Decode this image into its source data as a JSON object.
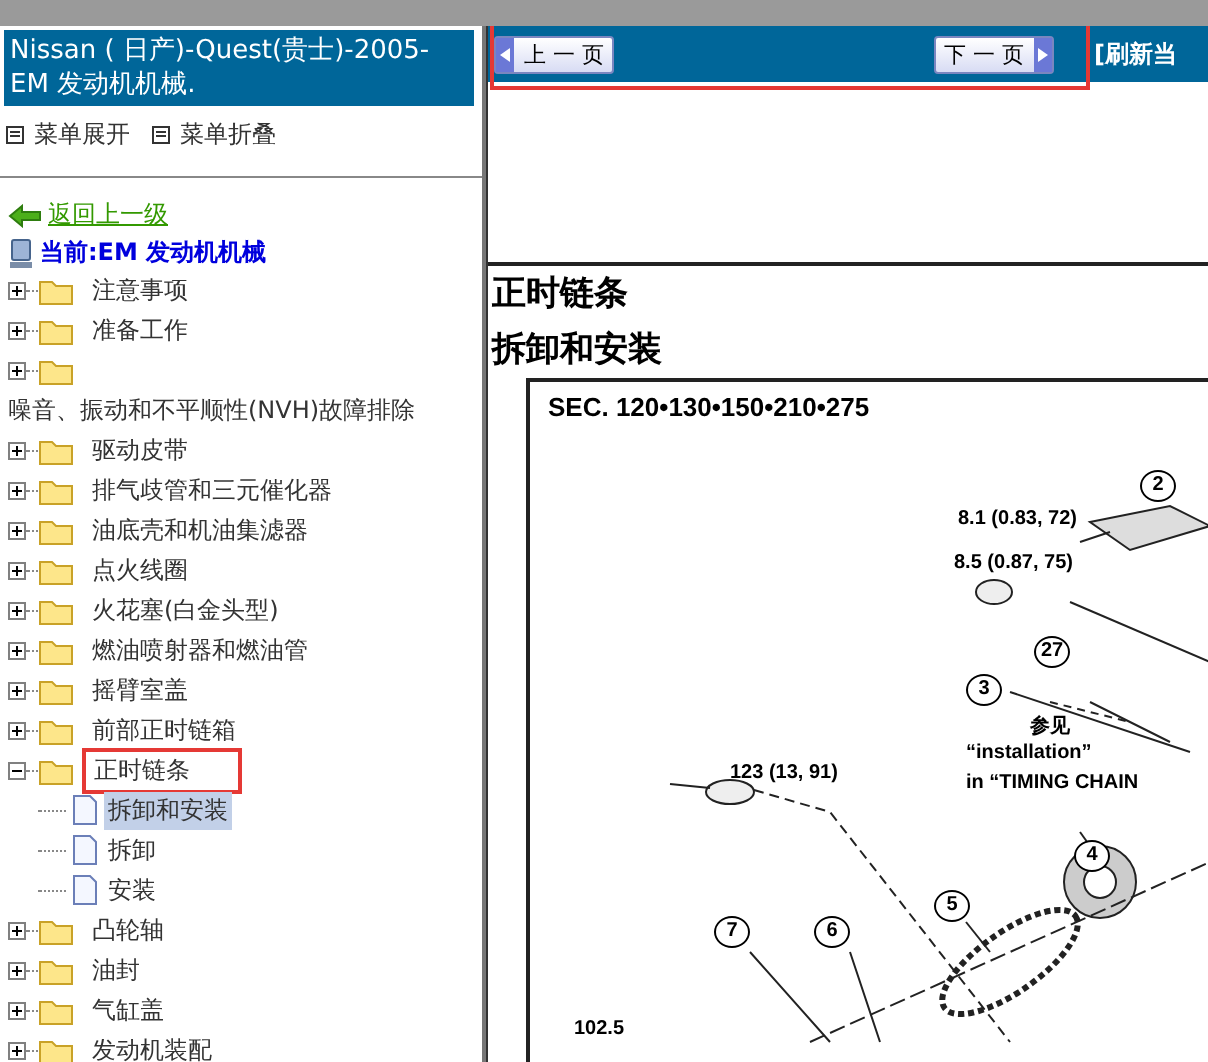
{
  "sidebar": {
    "title": "Nissan ( 日产)-Quest(贵士)-2005- EM 发动机机械.",
    "menu": [
      {
        "label": "菜单展开"
      },
      {
        "label": "菜单折叠"
      }
    ],
    "back_link": "返回上一级",
    "current": "当前:EM 发动机机械",
    "tree": [
      {
        "kind": "folder",
        "label": "注意事项",
        "expanded": false,
        "wrapped": false,
        "highlighted": false
      },
      {
        "kind": "folder",
        "label": "准备工作",
        "expanded": false,
        "wrapped": false,
        "highlighted": false
      },
      {
        "kind": "folder",
        "label": "噪音、振动和不平顺性(NVH)故障排除",
        "expanded": false,
        "wrapped": true,
        "highlighted": false
      },
      {
        "kind": "folder",
        "label": "驱动皮带",
        "expanded": false,
        "wrapped": false,
        "highlighted": false
      },
      {
        "kind": "folder",
        "label": "排气歧管和三元催化器",
        "expanded": false,
        "wrapped": false,
        "highlighted": false
      },
      {
        "kind": "folder",
        "label": "油底壳和机油集滤器",
        "expanded": false,
        "wrapped": false,
        "highlighted": false
      },
      {
        "kind": "folder",
        "label": "点火线圈",
        "expanded": false,
        "wrapped": false,
        "highlighted": false
      },
      {
        "kind": "folder",
        "label": "火花塞(白金头型)",
        "expanded": false,
        "wrapped": false,
        "highlighted": false
      },
      {
        "kind": "folder",
        "label": "燃油喷射器和燃油管",
        "expanded": false,
        "wrapped": false,
        "highlighted": false
      },
      {
        "kind": "folder",
        "label": "摇臂室盖",
        "expanded": false,
        "wrapped": false,
        "highlighted": false
      },
      {
        "kind": "folder",
        "label": "前部正时链箱",
        "expanded": false,
        "wrapped": false,
        "highlighted": false
      },
      {
        "kind": "folder",
        "label": "正时链条",
        "expanded": true,
        "wrapped": false,
        "highlighted": true,
        "children": [
          {
            "kind": "page",
            "label": "拆卸和安装",
            "selected": true
          },
          {
            "kind": "page",
            "label": "拆卸",
            "selected": false
          },
          {
            "kind": "page",
            "label": "安装",
            "selected": false
          }
        ]
      },
      {
        "kind": "folder",
        "label": "凸轮轴",
        "expanded": false,
        "wrapped": false,
        "highlighted": false
      },
      {
        "kind": "folder",
        "label": "油封",
        "expanded": false,
        "wrapped": false,
        "highlighted": false
      },
      {
        "kind": "folder",
        "label": "气缸盖",
        "expanded": false,
        "wrapped": false,
        "highlighted": false
      },
      {
        "kind": "folder",
        "label": "发动机装配",
        "expanded": false,
        "wrapped": false,
        "highlighted": false
      }
    ]
  },
  "content": {
    "nav": {
      "highlighted": true,
      "buttons": [
        {
          "kind": "prev",
          "label": "上 一 页"
        },
        {
          "kind": "next",
          "label": "下 一 页"
        }
      ],
      "refresh": "[刷新当"
    },
    "title": "正时链条",
    "subtitle": "拆卸和安装",
    "figure": {
      "section": "SEC. 120•130•150•210•275",
      "labels": [
        {
          "kind": "callout",
          "text": "2"
        },
        {
          "kind": "torque",
          "text": "8.1 (0.83, 72)"
        },
        {
          "kind": "torque",
          "text": "8.5 (0.87, 75)"
        },
        {
          "kind": "callout",
          "text": "27"
        },
        {
          "kind": "callout",
          "text": "3"
        },
        {
          "kind": "note",
          "text": "参见"
        },
        {
          "kind": "note",
          "text": "“installation”"
        },
        {
          "kind": "torque",
          "text": "123 (13, 91)"
        },
        {
          "kind": "note",
          "text": "in “TIMING CHAIN"
        },
        {
          "kind": "callout",
          "text": "4"
        },
        {
          "kind": "callout",
          "text": "5"
        },
        {
          "kind": "callout",
          "text": "7"
        },
        {
          "kind": "callout",
          "text": "6"
        },
        {
          "kind": "torque",
          "text": "102.5"
        }
      ]
    }
  }
}
